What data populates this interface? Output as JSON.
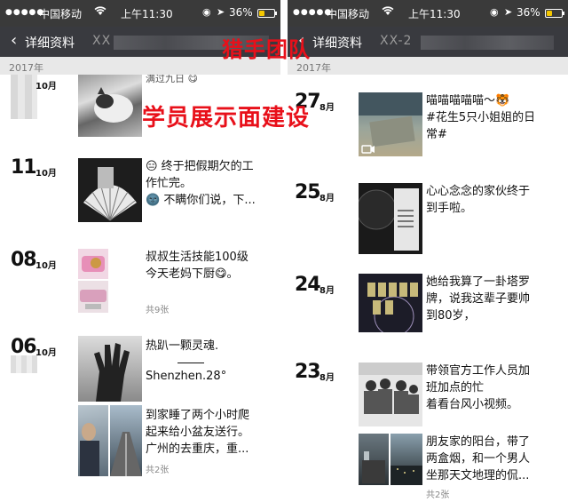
{
  "left": {
    "status": {
      "signal": "●●●●●",
      "carrier": "中国移动",
      "wifi": "wifi-icon",
      "time": "上午11:30",
      "battery": "36%",
      "battery_level": 0.36
    },
    "nav": {
      "back_label": "详细资料",
      "name": "XX"
    },
    "section_header": "2017年",
    "posts": [
      {
        "day": "",
        "month": "10月",
        "text": "满过九日",
        "thumb": "cat-photo"
      },
      {
        "day": "11",
        "month": "10月",
        "text": "😑 终于把假期欠的工作忙完。\n🌚 不瞒你们说，下...",
        "thumb": "fan-photo"
      },
      {
        "day": "08",
        "month": "10月",
        "text": "叔叔生活技能100级\n今天老妈下厨😋。",
        "count": "共9张",
        "thumb": "food-photos"
      },
      {
        "day": "06",
        "month": "10月",
        "text": "热趴一颗灵魂.\n——\nShenzhen.28°",
        "thumb": "hand-shadow-photo"
      },
      {
        "day": "",
        "month": "",
        "text": "到家睡了两个小时爬起来给小盆友送行。广州的去重庆，重...",
        "count": "共2张",
        "thumb": "street-photos"
      }
    ]
  },
  "right": {
    "status": {
      "signal": "●●●●●",
      "carrier": "中国移动",
      "wifi": "wifi-icon",
      "time": "上午11:30",
      "battery": "36%",
      "battery_level": 0.36
    },
    "nav": {
      "back_label": "详细资料",
      "name": "XX-2"
    },
    "section_header": "2017年",
    "posts": [
      {
        "day": "27",
        "month": "8月",
        "text": "喵喵喵喵喵～🐯\n#花生5只小姐姐的日常#",
        "thumb": "video-thumb"
      },
      {
        "day": "25",
        "month": "8月",
        "text": "心心念念的家伙终于到手啦。",
        "thumb": "cd-photo"
      },
      {
        "day": "24",
        "month": "8月",
        "text": "她给我算了一卦塔罗牌，说我这辈子要帅到80岁，",
        "thumb": "tarot-photo"
      },
      {
        "day": "23",
        "month": "8月",
        "text": "带领官方工作人员加班加点的忙\n着看台风小视频。",
        "thumb": "group-photo"
      },
      {
        "day": "",
        "month": "",
        "text": "朋友家的阳台，带了两盒烟，和一个男人坐那天文地理的侃...",
        "count": "共2张",
        "thumb": "balcony-photos"
      }
    ]
  },
  "watermark": {
    "line1": "猎手团队",
    "line2": "学员展示面建设"
  },
  "colors": {
    "statusbar": "#3a3a3a",
    "navbar": "#393a3f",
    "section": "#e8e8e8",
    "watermark": "#e8101a"
  }
}
